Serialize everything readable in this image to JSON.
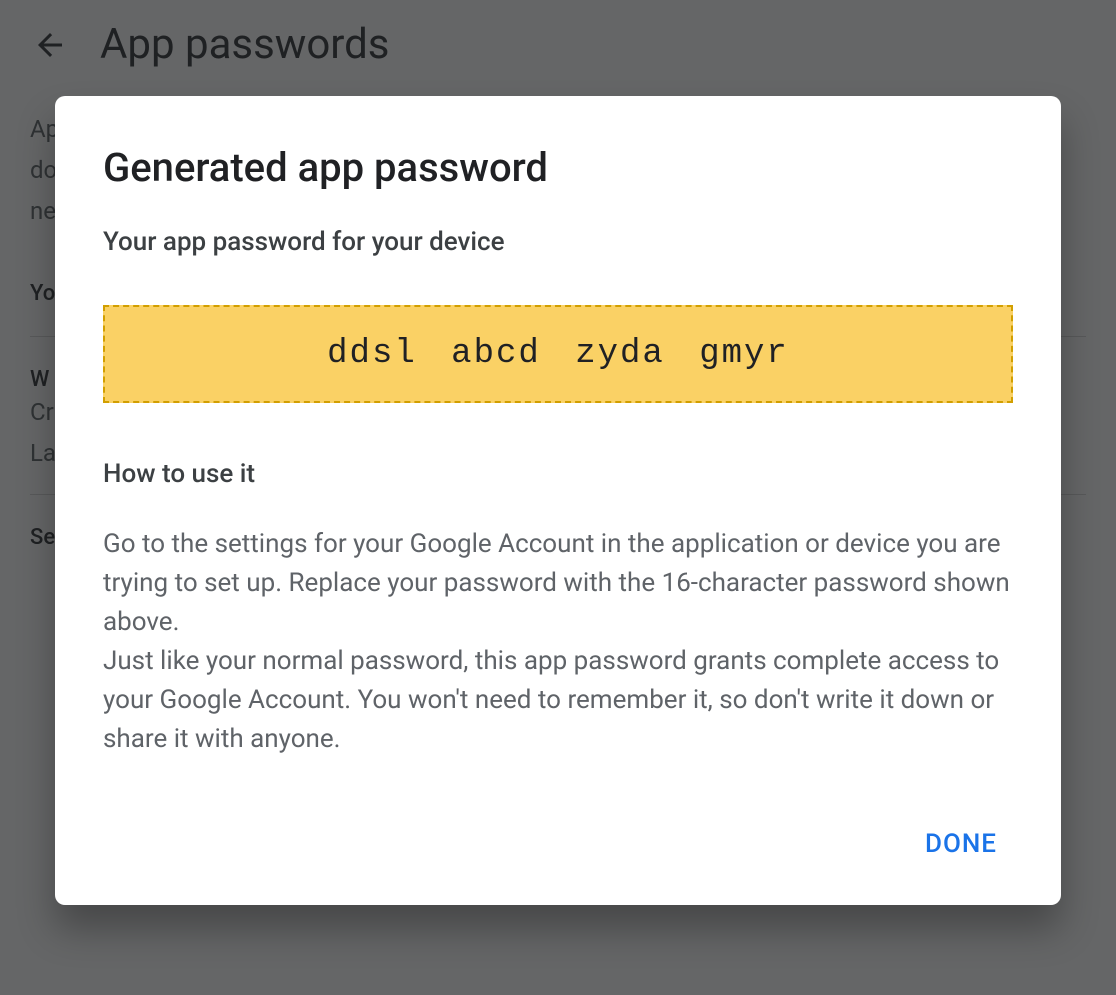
{
  "background": {
    "title": "App passwords",
    "desc_line1": "Ap",
    "desc_line2": "do",
    "desc_line3": "ne",
    "section_yo": "Yo",
    "section_w": "W",
    "section_cr": "Cr",
    "section_la": "La",
    "section_se": "Se"
  },
  "modal": {
    "title": "Generated app password",
    "subtitle": "Your app password for your device",
    "password": "ddsl abcd zyda gmyr",
    "howto_title": "How to use it",
    "howto_text": "Go to the settings for your Google Account in the application or device you are trying to set up. Replace your password with the 16-character password shown above.\nJust like your normal password, this app password grants complete access to your Google Account. You won't need to remember it, so don't write it down or share it with anyone.",
    "done_label": "DONE"
  }
}
